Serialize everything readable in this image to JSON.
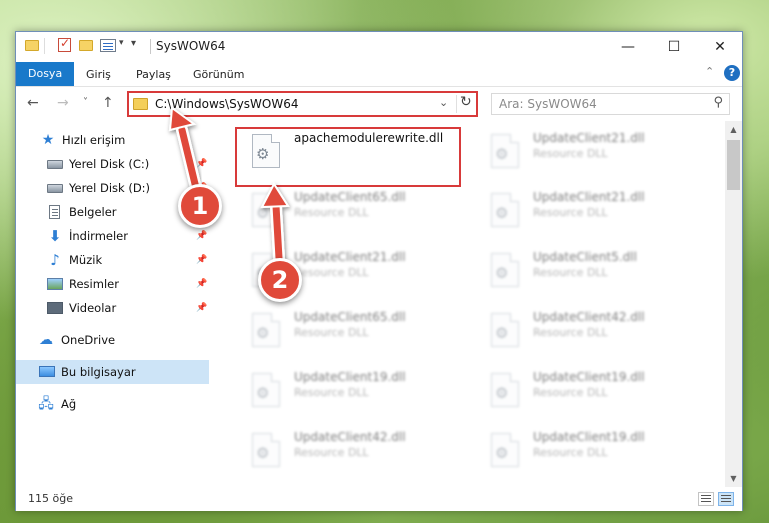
{
  "window": {
    "title": "SysWOW64",
    "controls": {
      "minimize": "—",
      "maximize": "☐",
      "close": "✕"
    }
  },
  "ribbon": {
    "tabs": [
      "Dosya",
      "Giriş",
      "Paylaş",
      "Görünüm"
    ],
    "help": "?"
  },
  "nav": {
    "back": "←",
    "forward": "→",
    "recent": "˅",
    "up": "↑",
    "address_path": "C:\\Windows\\SysWOW64",
    "search_placeholder": "Ara: SysWOW64"
  },
  "sidebar": {
    "items": [
      {
        "label": "Hızlı erişim",
        "icon": "star-icon"
      },
      {
        "label": "Yerel Disk (C:)",
        "icon": "disk-icon",
        "pinned": true
      },
      {
        "label": "Yerel Disk (D:)",
        "icon": "disk-icon",
        "pinned": true
      },
      {
        "label": "Belgeler",
        "icon": "documents-icon",
        "pinned": true
      },
      {
        "label": "İndirmeler",
        "icon": "download-icon",
        "pinned": true
      },
      {
        "label": "Müzik",
        "icon": "music-icon",
        "pinned": true
      },
      {
        "label": "Resimler",
        "icon": "pictures-icon",
        "pinned": true
      },
      {
        "label": "Videolar",
        "icon": "videos-icon",
        "pinned": true
      },
      {
        "label": "OneDrive",
        "icon": "cloud-icon"
      },
      {
        "label": "Bu bilgisayar",
        "icon": "computer-icon",
        "selected": true
      },
      {
        "label": "Ağ",
        "icon": "network-icon"
      }
    ]
  },
  "files": [
    {
      "name": "apachemodulerewrite.dll",
      "type": "",
      "blurred": false
    },
    {
      "name": "UpdateClient21.dll",
      "type": "Resource DLL",
      "blurred": true
    },
    {
      "name": "UpdateClient65.dll",
      "type": "Resource DLL",
      "blurred": true
    },
    {
      "name": "UpdateClient21.dll",
      "type": "Resource DLL",
      "blurred": true
    },
    {
      "name": "UpdateClient21.dll",
      "type": "Resource DLL",
      "blurred": true
    },
    {
      "name": "UpdateClient5.dll",
      "type": "Resource DLL",
      "blurred": true
    },
    {
      "name": "UpdateClient65.dll",
      "type": "Resource DLL",
      "blurred": true
    },
    {
      "name": "UpdateClient42.dll",
      "type": "Resource DLL",
      "blurred": true
    },
    {
      "name": "UpdateClient19.dll",
      "type": "Resource DLL",
      "blurred": true
    },
    {
      "name": "UpdateClient19.dll",
      "type": "Resource DLL",
      "blurred": true
    },
    {
      "name": "UpdateClient42.dll",
      "type": "Resource DLL",
      "blurred": true
    },
    {
      "name": "UpdateClient19.dll",
      "type": "Resource DLL",
      "blurred": true
    }
  ],
  "status": {
    "item_count": "115 öğe"
  },
  "annotations": {
    "step1": "1",
    "step2": "2",
    "color": "#e04a3a"
  }
}
